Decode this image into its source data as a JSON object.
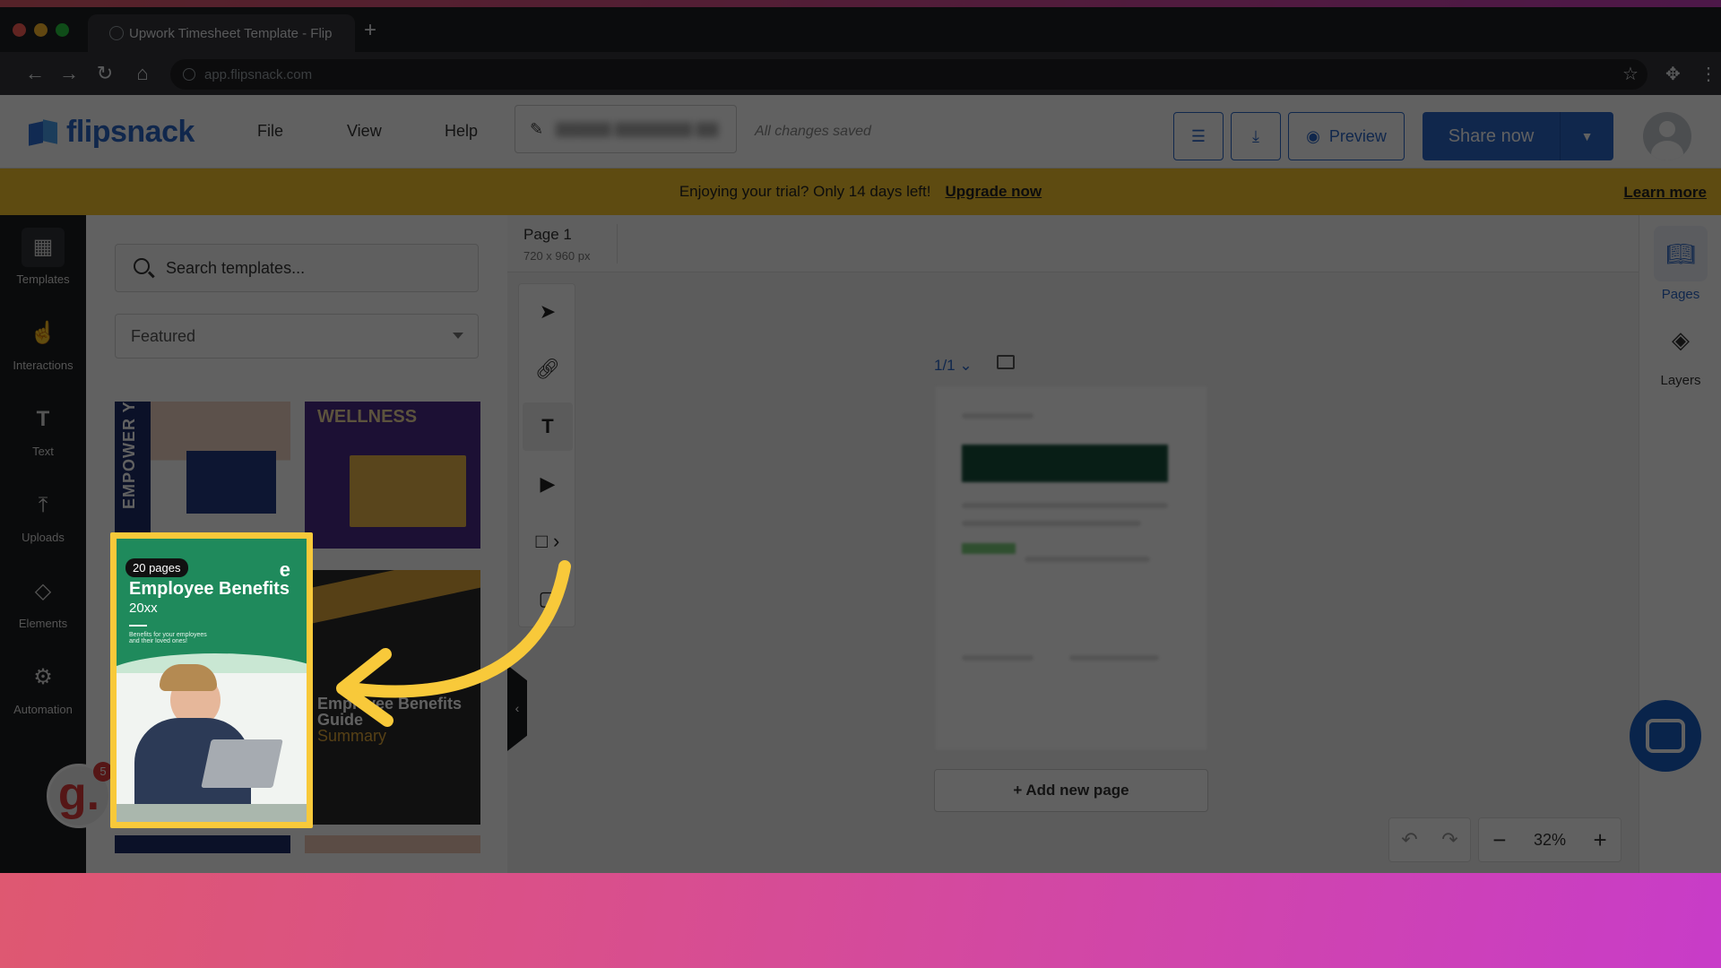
{
  "browser": {
    "tab_title": "Upwork Timesheet Template - Flip",
    "new_tab": "+",
    "url": "app.flipsnack.com"
  },
  "app": {
    "logo_text": "flipsnack",
    "menu": [
      "File",
      "View",
      "Help"
    ],
    "save_status": "All changes saved",
    "preview_label": "Preview",
    "share_label": "Share now"
  },
  "trial_banner": {
    "text": "Enjoying your trial? Only 14 days left!",
    "upgrade": "Upgrade now",
    "learn_more": "Learn more"
  },
  "rail": {
    "items": [
      {
        "label": "Templates",
        "icon": "templates-icon"
      },
      {
        "label": "Interactions",
        "icon": "interactions-icon"
      },
      {
        "label": "Text",
        "icon": "text-icon"
      },
      {
        "label": "Uploads",
        "icon": "upload-icon"
      },
      {
        "label": "Elements",
        "icon": "elements-icon"
      },
      {
        "label": "Automation",
        "icon": "robot-icon"
      }
    ]
  },
  "templates_panel": {
    "search_placeholder": "Search templates...",
    "filter": "Featured",
    "cards": [
      {
        "text": "EMPOWER YOUR FUTU"
      },
      {
        "text": "WELLNESS"
      },
      {
        "badge": "20 pages",
        "title": "Employee Benefits",
        "year": "20xx",
        "subtitle": "Benefits for your employees and their loved ones!"
      },
      {
        "title": "Employee Benefits Guide",
        "accent": "Summary"
      }
    ]
  },
  "canvas": {
    "page_title": "Page 1",
    "page_size": "720 x 960 px",
    "page_counter": "1/1",
    "add_page": "+ Add new page",
    "zoom": "32%"
  },
  "right_rail": {
    "items": [
      {
        "label": "Pages",
        "icon": "book-icon"
      },
      {
        "label": "Layers",
        "icon": "layers-icon"
      }
    ]
  },
  "notifications": {
    "badge_letter": "g.",
    "count": "5"
  },
  "colors": {
    "brand": "#2c67c9",
    "banner": "#f6c52d",
    "highlight": "#f8c93a"
  }
}
